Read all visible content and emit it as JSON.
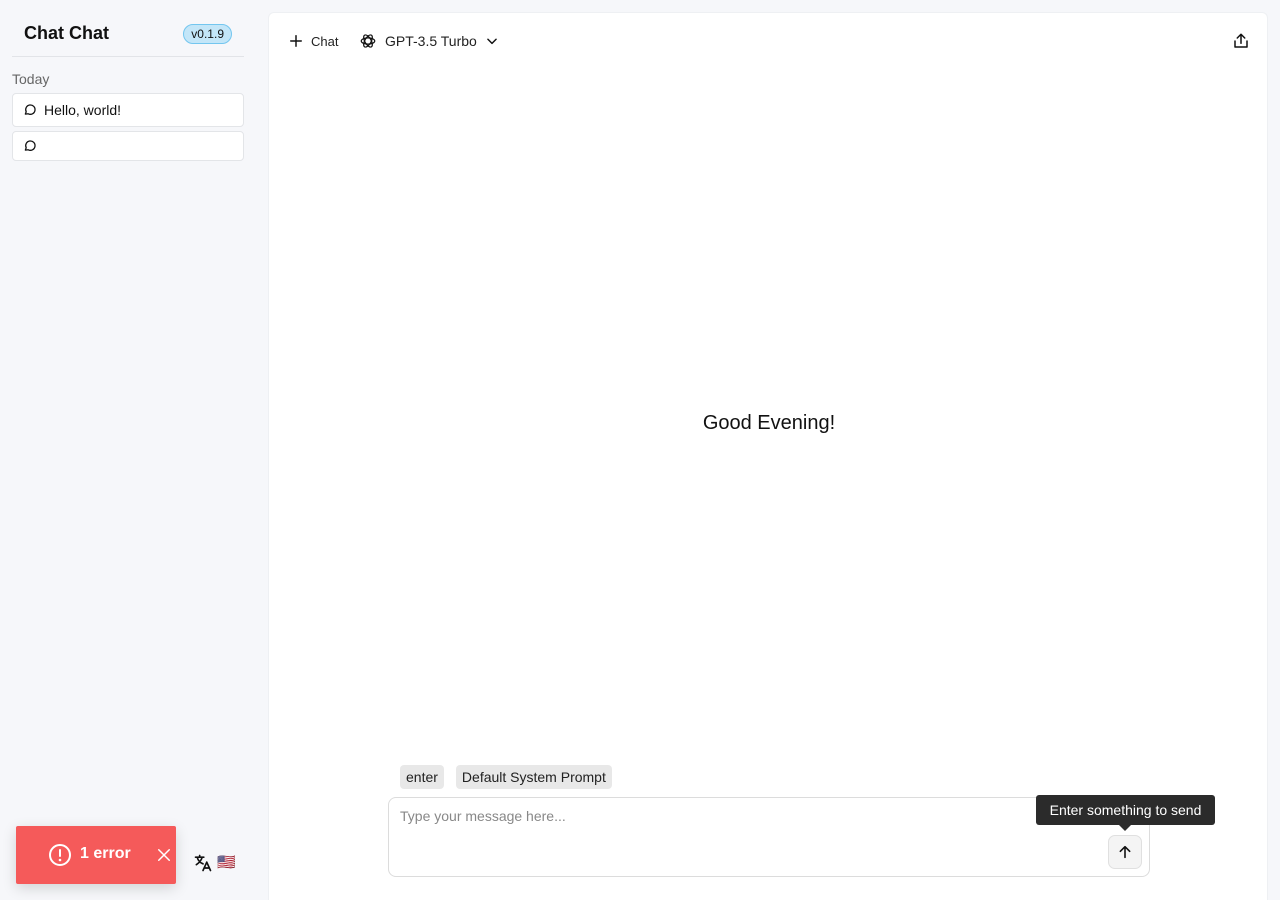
{
  "sidebar": {
    "app_title": "Chat Chat",
    "version": "v0.1.9",
    "group_label": "Today",
    "conversations": [
      {
        "label": "Hello, world!"
      },
      {
        "label": ""
      }
    ],
    "language_flag": "🇺🇸"
  },
  "toast": {
    "text": "1 error",
    "color": "#f55a5a"
  },
  "header": {
    "new_chat_label": "Chat",
    "model_name": "GPT-3.5 Turbo"
  },
  "main": {
    "greeting": "Good Evening!"
  },
  "composer": {
    "chips": [
      "enter",
      "Default System Prompt"
    ],
    "placeholder": "Type your message here...",
    "send_tooltip": "Enter something to send"
  },
  "colors": {
    "accent_badge": "#c3e6f8",
    "error": "#f55a5a",
    "tooltip_bg": "#2b2b2b"
  },
  "icons": [
    "message-icon",
    "translate-icon",
    "alert-circle-icon",
    "close-icon",
    "plus-icon",
    "openai-icon",
    "chevron-down-icon",
    "share-icon",
    "arrow-up-icon"
  ]
}
